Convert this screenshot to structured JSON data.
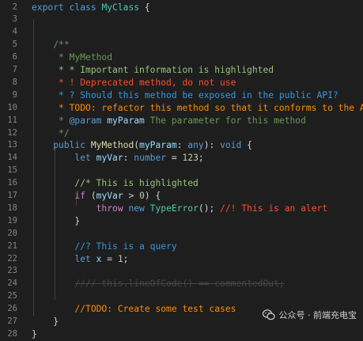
{
  "editor": {
    "lines": [
      {
        "n": "2",
        "tokens": [
          {
            "c": "t-kw",
            "t": "export"
          },
          {
            "t": " "
          },
          {
            "c": "t-kw",
            "t": "class"
          },
          {
            "t": " "
          },
          {
            "c": "t-cls",
            "t": "MyClass"
          },
          {
            "t": " {"
          }
        ]
      },
      {
        "n": "3",
        "tokens": []
      },
      {
        "n": "4",
        "tokens": []
      },
      {
        "n": "5",
        "tokens": [
          {
            "t": "    "
          },
          {
            "c": "t-cm",
            "t": "/**"
          }
        ]
      },
      {
        "n": "6",
        "tokens": [
          {
            "t": "     "
          },
          {
            "c": "t-cm",
            "t": "* MyMethod"
          }
        ]
      },
      {
        "n": "7",
        "tokens": [
          {
            "t": "     "
          },
          {
            "c": "t-hl",
            "t": "* * Important information is highlighted"
          }
        ]
      },
      {
        "n": "8",
        "tokens": [
          {
            "t": "     "
          },
          {
            "c": "t-alert",
            "t": "* ! Deprecated method, do not use"
          }
        ]
      },
      {
        "n": "9",
        "tokens": [
          {
            "t": "     "
          },
          {
            "c": "t-query",
            "t": "* ? Should this method be exposed in the public API?"
          }
        ]
      },
      {
        "n": "10",
        "tokens": [
          {
            "t": "     "
          },
          {
            "c": "t-todo",
            "t": "* TODO: refactor this method so that it conforms to the API"
          }
        ]
      },
      {
        "n": "11",
        "tokens": [
          {
            "t": "     "
          },
          {
            "c": "t-cm",
            "t": "* "
          },
          {
            "c": "t-kw",
            "t": "@param"
          },
          {
            "t": " "
          },
          {
            "c": "t-var",
            "t": "myParam"
          },
          {
            "c": "t-cm",
            "t": " The parameter for this method"
          }
        ]
      },
      {
        "n": "12",
        "tokens": [
          {
            "t": "     "
          },
          {
            "c": "t-cm",
            "t": "*/"
          }
        ]
      },
      {
        "n": "13",
        "tokens": [
          {
            "t": "    "
          },
          {
            "c": "t-kw",
            "t": "public"
          },
          {
            "t": " "
          },
          {
            "c": "t-fn",
            "t": "MyMethod"
          },
          {
            "t": "("
          },
          {
            "c": "t-var",
            "t": "myParam"
          },
          {
            "t": ": "
          },
          {
            "c": "t-kw",
            "t": "any"
          },
          {
            "t": "): "
          },
          {
            "c": "t-kw",
            "t": "void"
          },
          {
            "t": " {"
          }
        ]
      },
      {
        "n": "14",
        "tokens": [
          {
            "t": "        "
          },
          {
            "c": "t-kw",
            "t": "let"
          },
          {
            "t": " "
          },
          {
            "c": "t-var",
            "t": "myVar"
          },
          {
            "t": ": "
          },
          {
            "c": "t-kw",
            "t": "number"
          },
          {
            "t": " = "
          },
          {
            "c": "t-num",
            "t": "123"
          },
          {
            "t": ";"
          }
        ]
      },
      {
        "n": "15",
        "tokens": []
      },
      {
        "n": "16",
        "tokens": [
          {
            "t": "        "
          },
          {
            "c": "t-hl",
            "t": "//* This is highlighted"
          }
        ]
      },
      {
        "n": "17",
        "tokens": [
          {
            "t": "        "
          },
          {
            "c": "t-ctl",
            "t": "if"
          },
          {
            "t": " ("
          },
          {
            "c": "t-var",
            "t": "myVar"
          },
          {
            "t": " > "
          },
          {
            "c": "t-num",
            "t": "0"
          },
          {
            "t": ") {"
          }
        ]
      },
      {
        "n": "18",
        "tokens": [
          {
            "t": "            "
          },
          {
            "c": "t-ctl",
            "t": "throw"
          },
          {
            "t": " "
          },
          {
            "c": "t-kw",
            "t": "new"
          },
          {
            "t": " "
          },
          {
            "c": "t-cls",
            "t": "TypeError"
          },
          {
            "t": "(); "
          },
          {
            "c": "t-alert",
            "t": "//! This is an alert"
          }
        ]
      },
      {
        "n": "19",
        "tokens": [
          {
            "t": "        }"
          }
        ]
      },
      {
        "n": "20",
        "tokens": []
      },
      {
        "n": "21",
        "tokens": [
          {
            "t": "        "
          },
          {
            "c": "t-query",
            "t": "//? This is a query"
          }
        ]
      },
      {
        "n": "22",
        "tokens": [
          {
            "t": "        "
          },
          {
            "c": "t-kw",
            "t": "let"
          },
          {
            "t": " "
          },
          {
            "c": "t-var",
            "t": "x"
          },
          {
            "t": " = "
          },
          {
            "c": "t-num",
            "t": "1"
          },
          {
            "t": ";"
          }
        ]
      },
      {
        "n": "23",
        "tokens": []
      },
      {
        "n": "24",
        "tokens": [
          {
            "t": "        "
          },
          {
            "c": "t-strike",
            "t": "//// this.lineOfCode() == commentedOut;"
          }
        ]
      },
      {
        "n": "25",
        "tokens": []
      },
      {
        "n": "26",
        "tokens": [
          {
            "t": "        "
          },
          {
            "c": "t-todo",
            "t": "//TODO: Create some test cases"
          }
        ]
      },
      {
        "n": "27",
        "tokens": [
          {
            "t": "    }"
          }
        ]
      },
      {
        "n": "28",
        "tokens": [
          {
            "t": "}"
          }
        ]
      }
    ]
  },
  "watermark": {
    "text": "公众号 · 前端充电宝",
    "icon": "wechat-icon",
    "color": "#d0d0d0"
  }
}
